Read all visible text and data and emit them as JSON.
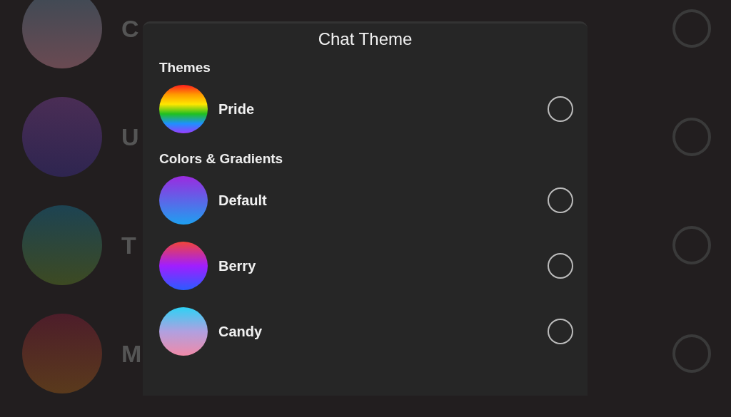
{
  "background_list": [
    {
      "label": "C",
      "kind": "slate",
      "selected": false
    },
    {
      "label": "U",
      "kind": "plum",
      "selected": false
    },
    {
      "label": "T",
      "kind": "teal",
      "selected": false
    },
    {
      "label": "M",
      "kind": "rust",
      "selected": false
    }
  ],
  "sheet": {
    "title": "Chat Theme",
    "sections": [
      {
        "heading": "Themes",
        "items": [
          {
            "label": "Pride",
            "kind": "rainbow",
            "selected": false
          }
        ]
      },
      {
        "heading": "Colors & Gradients",
        "items": [
          {
            "label": "Default",
            "kind": "violet",
            "selected": false
          },
          {
            "label": "Berry",
            "kind": "berry",
            "selected": false
          },
          {
            "label": "Candy",
            "kind": "candy",
            "selected": false
          }
        ]
      }
    ]
  }
}
